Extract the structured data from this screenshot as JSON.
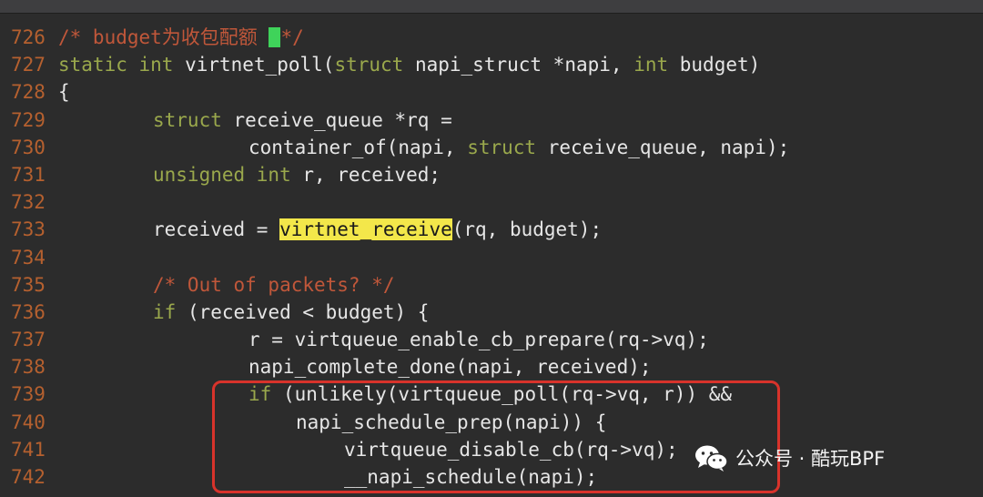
{
  "editor": {
    "lines": [
      {
        "num": "726",
        "comment": "/* budget为收包配额 ",
        "comment_end": "*/"
      },
      {
        "num": "727",
        "kw1": "static int",
        "text": " virtnet_poll(",
        "kw2": "struct",
        "text2": " napi_struct *napi, ",
        "kw3": "int",
        "text3": " budget)"
      },
      {
        "num": "728",
        "text": "{"
      },
      {
        "num": "729",
        "kw1": "struct",
        "text": " receive_queue *rq ="
      },
      {
        "num": "730",
        "text": "container_of(napi, ",
        "kw1": "struct",
        "text2": " receive_queue, napi);"
      },
      {
        "num": "731",
        "kw1": "unsigned int",
        "text": " r, received;"
      },
      {
        "num": "732"
      },
      {
        "num": "733",
        "text": "received = ",
        "highlight": "virtnet_receive",
        "text2": "(rq, budget);"
      },
      {
        "num": "734"
      },
      {
        "num": "735",
        "comment": "/* Out of packets? */"
      },
      {
        "num": "736",
        "kw1": "if",
        "text": " (received < budget) {"
      },
      {
        "num": "737",
        "text": "r = virtqueue_enable_cb_prepare(rq->vq);"
      },
      {
        "num": "738",
        "text": "napi_complete_done(napi, received);"
      },
      {
        "num": "739",
        "kw1": "if",
        "text": " (unlikely(virtqueue_poll(rq->vq, r)) &&"
      },
      {
        "num": "740",
        "text": "napi_schedule_prep(napi)) {"
      },
      {
        "num": "741",
        "text": "virtqueue_disable_cb(rq->vq);"
      },
      {
        "num": "742",
        "text": "__napi_schedule(napi);"
      }
    ]
  },
  "watermark": {
    "text": "公众号 · 酷玩BPF",
    "icon": "wechat-icon"
  },
  "colors": {
    "background": "#2c2c2c",
    "line_number": "#b5602f",
    "keyword": "#9aa84c",
    "comment": "#c0573a",
    "highlight": "#f3e74a",
    "cursor": "#3fd35a",
    "annotation_box": "#d8332b"
  }
}
